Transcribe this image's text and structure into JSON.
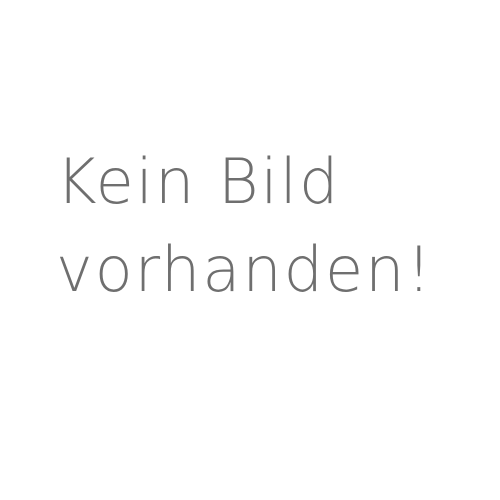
{
  "placeholder": {
    "line1": "Kein Bild",
    "line2": "vorhanden!",
    "text_color": "#6f6f6f",
    "background_color": "#ffffff"
  }
}
